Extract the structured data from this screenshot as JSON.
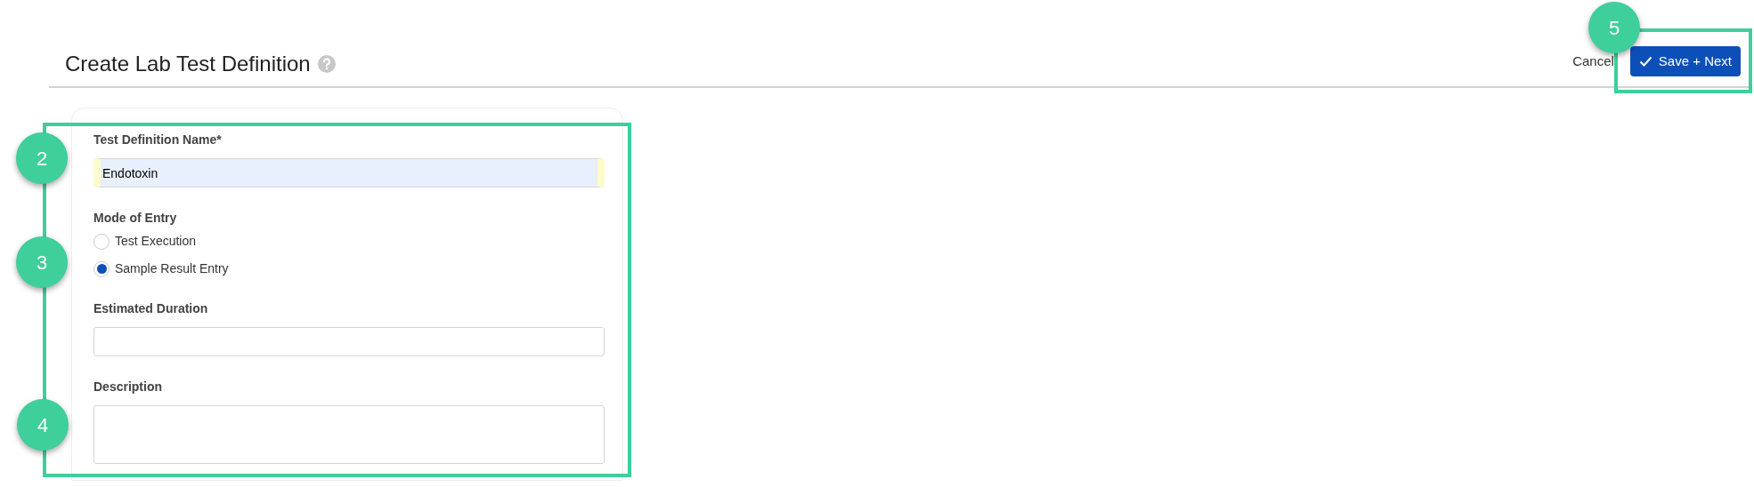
{
  "header": {
    "title": "Create Lab Test Definition",
    "cancel": "Cancel",
    "save": "Save + Next"
  },
  "form": {
    "fields": [
      {
        "kind": "text",
        "label": "Test Definition Name*",
        "value": "Endotoxin",
        "autofilled": true
      },
      {
        "kind": "radio",
        "label": "Mode of Entry",
        "options": [
          {
            "label": "Test Execution",
            "selected": false
          },
          {
            "label": "Sample Result Entry",
            "selected": true
          }
        ]
      },
      {
        "kind": "text",
        "label": "Estimated Duration"
      },
      {
        "kind": "textarea",
        "label": "Description"
      }
    ]
  },
  "callouts": [
    {
      "number": "2"
    },
    {
      "number": "3"
    },
    {
      "number": "4"
    },
    {
      "number": "5"
    }
  ]
}
